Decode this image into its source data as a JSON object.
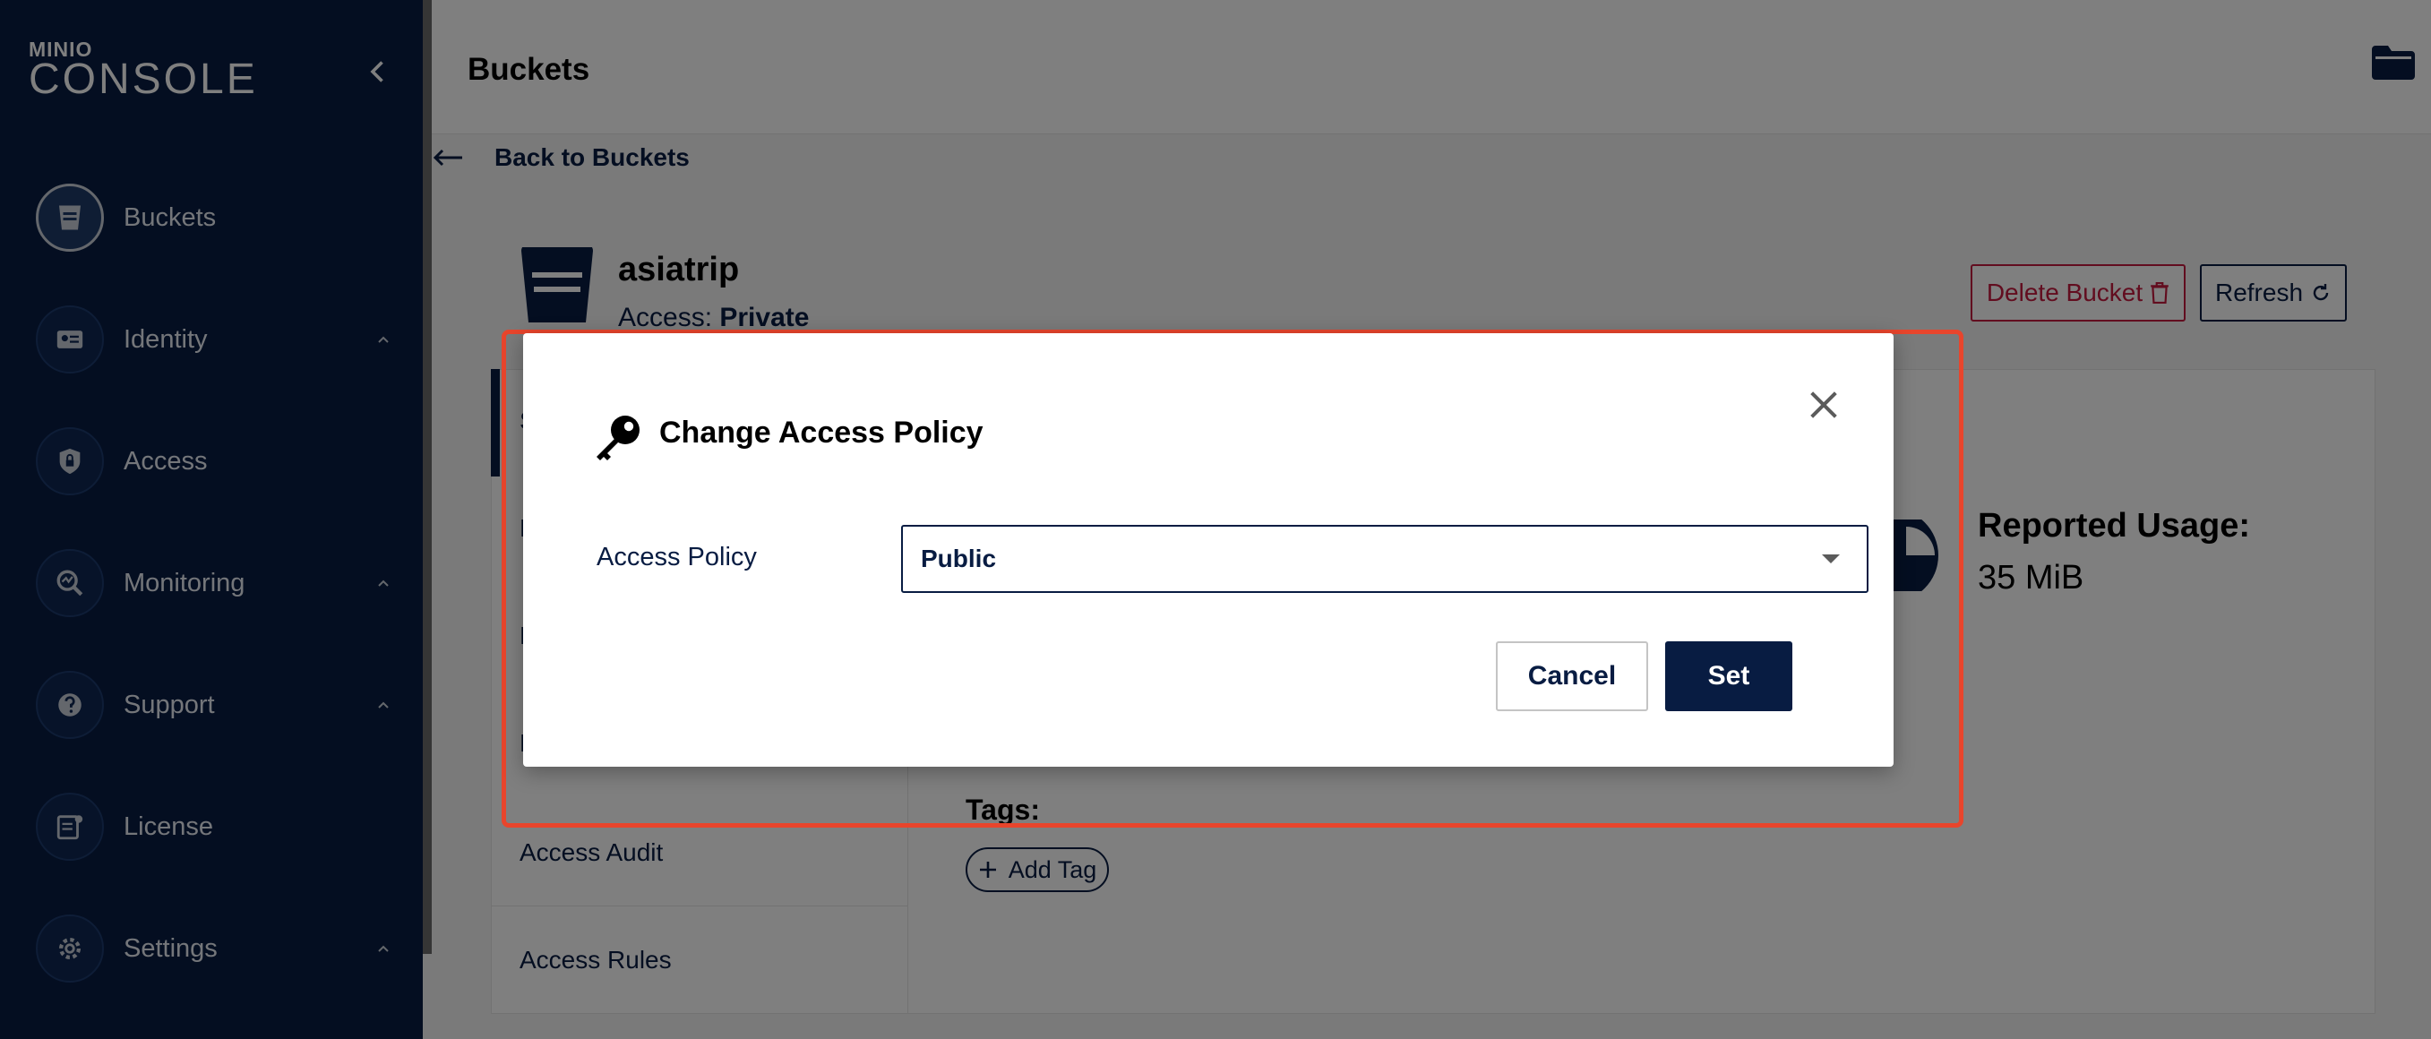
{
  "app": {
    "logo_top": "MINIO",
    "logo_bottom": "CONSOLE"
  },
  "sidebar": {
    "items": [
      {
        "label": "Buckets",
        "icon": "bucket-icon",
        "active": true
      },
      {
        "label": "Identity",
        "icon": "id-card-icon",
        "expandable": true
      },
      {
        "label": "Access",
        "icon": "lock-shield-icon"
      },
      {
        "label": "Monitoring",
        "icon": "magnifier-chart-icon",
        "expandable": true
      },
      {
        "label": "Support",
        "icon": "support-icon",
        "expandable": true
      },
      {
        "label": "License",
        "icon": "license-icon"
      },
      {
        "label": "Settings",
        "icon": "gear-icon",
        "expandable": true
      }
    ]
  },
  "header": {
    "title": "Buckets"
  },
  "back_link": "Back to Buckets",
  "bucket": {
    "name": "asiatrip",
    "access_prefix": "Access:",
    "access_value": "Private"
  },
  "actions": {
    "delete_label": "Delete Bucket",
    "refresh_label": "Refresh"
  },
  "tabs": [
    {
      "label": "S"
    },
    {
      "label": "E"
    },
    {
      "label": "E"
    },
    {
      "label": "L"
    },
    {
      "label": "Access Audit"
    },
    {
      "label": "Access Rules"
    }
  ],
  "summary": {
    "usage_label": "Reported Usage:",
    "usage_value": "35 MiB",
    "tags_label": "Tags:",
    "add_tag_label": "Add Tag"
  },
  "modal": {
    "title": "Change Access Policy",
    "field_label": "Access Policy",
    "selected_value": "Public",
    "cancel_label": "Cancel",
    "set_label": "Set"
  },
  "colors": {
    "navy": "#081c42",
    "danger": "#c51b3f",
    "highlight": "#e8452c"
  }
}
